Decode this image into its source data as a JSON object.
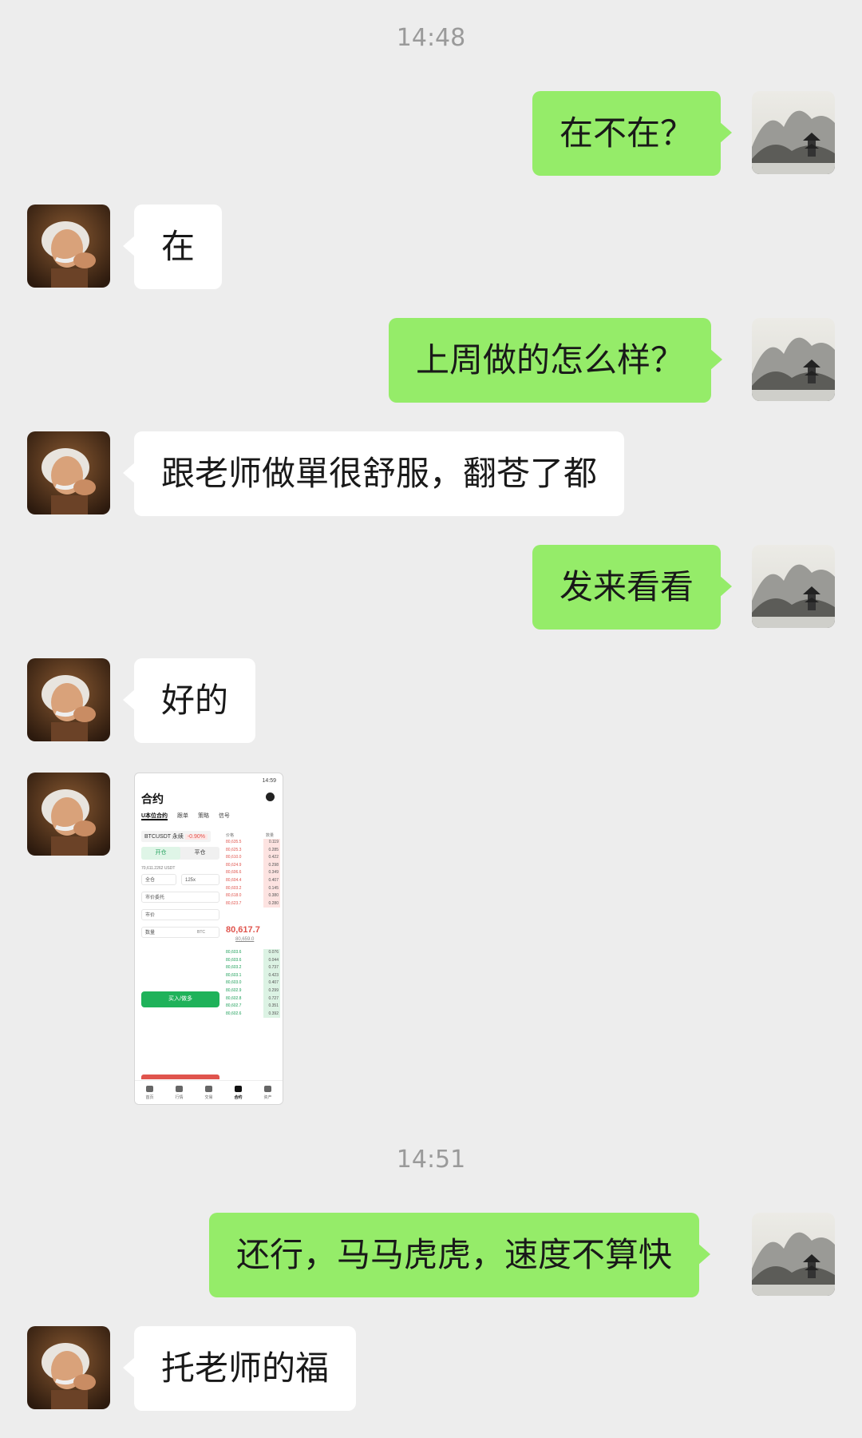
{
  "timestamps": [
    "14:48",
    "14:51"
  ],
  "messages": [
    {
      "side": "me",
      "text": "在不在？"
    },
    {
      "side": "other",
      "text": "在"
    },
    {
      "side": "me",
      "text": "上周做的怎么样？"
    },
    {
      "side": "other",
      "text": "跟老师做單很舒服，翻苍了都"
    },
    {
      "side": "me",
      "text": "发来看看"
    },
    {
      "side": "other",
      "text": "好的"
    },
    {
      "side": "other",
      "type": "image",
      "text": "screenshot-thumbnail"
    },
    {
      "side": "me",
      "text": "还行，马马虎虎，速度不算快"
    },
    {
      "side": "other",
      "text": "托老师的福"
    }
  ],
  "avatars": {
    "me": "ink-landscape-pagoda-avatar",
    "other": "einstein-portrait-avatar"
  },
  "thumbnail": {
    "status_time": "14:59",
    "title": "合约",
    "tabs": [
      "U本位合约",
      "跟单",
      "策略",
      "信号"
    ],
    "pair": "BTCUSDT 永续",
    "change": "-0.90%",
    "open_label": "开仓",
    "close_label": "平仓",
    "available": "70,611.2262 USDT",
    "margin_mode": "全仓",
    "leverage": "125x",
    "order_type": "市价委托",
    "price_placeholder": "市价",
    "amount_placeholder": "数量",
    "amount_unit": "BTC",
    "buy_label": "买入/做多",
    "book_header_price": "价格",
    "book_header_qty": "数量",
    "asks": [
      {
        "price": "80,635.5",
        "qty": "0.119"
      },
      {
        "price": "80,625.3",
        "qty": "0.285"
      },
      {
        "price": "80,610.0",
        "qty": "0.422"
      },
      {
        "price": "80,624.9",
        "qty": "0.298"
      },
      {
        "price": "80,606.6",
        "qty": "0.349"
      },
      {
        "price": "80,604.4",
        "qty": "0.407"
      },
      {
        "price": "80,603.2",
        "qty": "0.145"
      },
      {
        "price": "80,618.0",
        "qty": "0.380"
      },
      {
        "price": "80,623.7",
        "qty": "0.280"
      }
    ],
    "mid_price": "80,617.7",
    "mid_sub": "80,659.0",
    "bids": [
      {
        "price": "80,603.6",
        "qty": "0.076"
      },
      {
        "price": "80,603.6",
        "qty": "0.044"
      },
      {
        "price": "80,603.2",
        "qty": "0.737"
      },
      {
        "price": "80,603.1",
        "qty": "0.423"
      },
      {
        "price": "80,603.0",
        "qty": "0.407"
      },
      {
        "price": "80,602.9",
        "qty": "0.299"
      },
      {
        "price": "80,602.8",
        "qty": "0.727"
      },
      {
        "price": "80,602.7",
        "qty": "0.351"
      },
      {
        "price": "80,602.6",
        "qty": "0.392"
      }
    ],
    "nav": [
      "首页",
      "行情",
      "交易",
      "合约",
      "资产"
    ]
  },
  "colors": {
    "my_bubble": "#95ec69",
    "other_bubble": "#ffffff",
    "background": "#ededed"
  }
}
